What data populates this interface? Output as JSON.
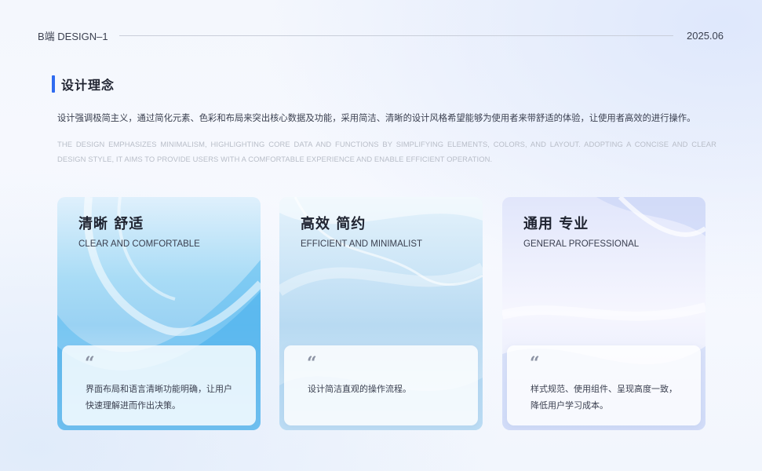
{
  "header": {
    "brand": "B端 DESIGN–1",
    "date": "2025.06"
  },
  "section": {
    "title": "设计理念",
    "desc_cn": "设计强调极简主义，通过简化元素、色彩和布局来突出核心数据及功能，采用简洁、清晰的设计风格希望能够为使用者来带舒适的体验，让使用者高效的进行操作。",
    "desc_en": "THE DESIGN EMPHASIZES MINIMALISM, HIGHLIGHTING CORE DATA AND FUNCTIONS BY SIMPLIFYING ELEMENTS, COLORS, AND LAYOUT. ADOPTING A CONCISE AND CLEAR DESIGN STYLE, IT AIMS TO PROVIDE USERS WITH A COMFORTABLE EXPERIENCE AND ENABLE EFFICIENT OPERATION."
  },
  "cards": [
    {
      "title": "清晰 舒适",
      "subtitle": "CLEAR AND COMFORTABLE",
      "quote_mark": "“",
      "text": "界面布局和语言清晰功能明确，让用户快速理解进而作出决策。"
    },
    {
      "title": "高效 简约",
      "subtitle": "EFFICIENT AND MINIMALIST",
      "quote_mark": "“",
      "text": "设计简洁直观的操作流程。"
    },
    {
      "title": "通用 专业",
      "subtitle": "GENERAL PROFESSIONAL",
      "quote_mark": "“",
      "text": "样式规范、使用组件、呈现高度一致，降低用户学习成本。"
    }
  ],
  "colors": {
    "accent": "#2f6bf0",
    "text": "#3b4050",
    "muted": "#b8bdc8"
  }
}
